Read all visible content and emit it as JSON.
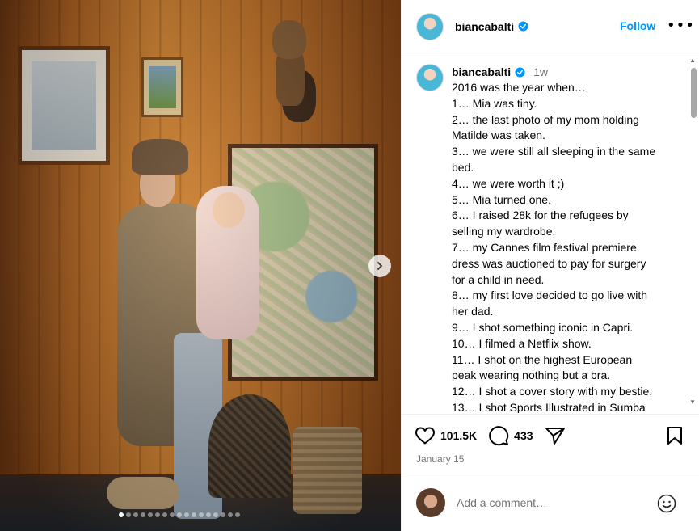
{
  "post": {
    "username": "biancabalti",
    "follow_label": "Follow",
    "more_label": "•••",
    "age": "1w",
    "caption_lines": [
      "2016 was the year when…",
      "1… Mia was tiny.",
      "2… the last photo of my mom holding",
      "Matilde was taken.",
      "3… we were still all sleeping in the same",
      "bed.",
      "4… we were worth it ;)",
      "5… Mia turned one.",
      "6… I raised 28k for the refugees by",
      "selling my wardrobe.",
      "7… my Cannes film festival premiere",
      "dress was auctioned to pay for surgery",
      "for a child in need.",
      "8… my first love decided to go live with",
      "her dad.",
      "9… I shot something iconic in Capri.",
      "10… I filmed a Netflix show.",
      "11… I shot on the highest European",
      "peak wearing nothing but a bra.",
      "12… I shot a cover story with my bestie.",
      "13… I shot Sports Illustrated in Sumba"
    ],
    "likes": "101.5K",
    "comments": "433",
    "date": "January 15",
    "comment_placeholder": "Add a comment…",
    "carousel_total": 17,
    "carousel_active": 1
  },
  "colors": {
    "accent": "#0095f6",
    "muted": "#737373",
    "verified": "#0095f6"
  }
}
